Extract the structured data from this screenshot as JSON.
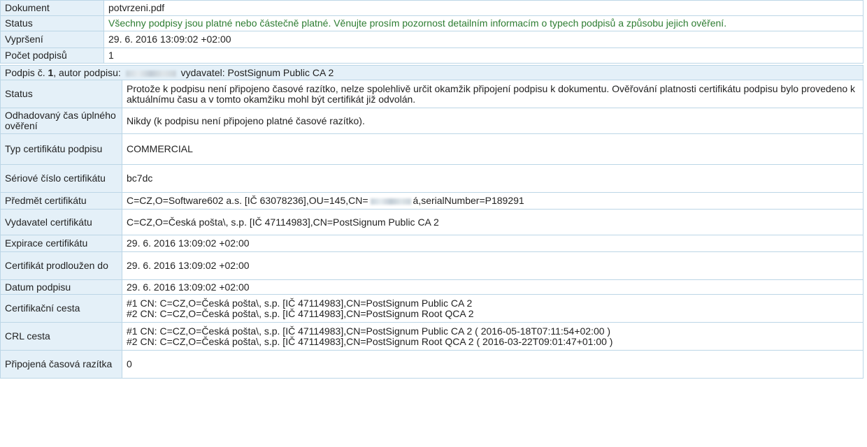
{
  "document": {
    "rows": [
      {
        "label": "Dokument",
        "value": "potvrzeni.pdf"
      },
      {
        "label": "Status",
        "value": "Všechny podpisy jsou platné nebo částečně platné. Věnujte prosím pozornost detailním informacím o typech podpisů a způsobu jejich ověření."
      },
      {
        "label": "Vypršení",
        "value": "29. 6. 2016 13:09:02 +02:00"
      },
      {
        "label": "Počet podpisů",
        "value": "1"
      }
    ]
  },
  "signature": {
    "header_prefix": "Podpis č.",
    "number": "1",
    "author_label": ", autor podpisu:",
    "issuer_label": "vydavatel: PostSignum Public CA 2",
    "status_label": "Status",
    "status_value": "Protože k podpisu není připojeno časové razítko, nelze spolehlivě určit okamžik připojení podpisu k dokumentu. Ověřování platnosti certifikátu podpisu bylo provedeno k aktuálnímu času a v tomto okamžiku mohl být certifikát již odvolán.",
    "estimated_time_label": "Odhadovaný čas úplného ověření",
    "estimated_time_value": "Nikdy (k podpisu není připojeno platné časové razítko).",
    "cert_type_label": "Typ certifikátu podpisu",
    "cert_type_value": "COMMERCIAL",
    "serial_label": "Sériové číslo certifikátu",
    "serial_value": "bc7dc",
    "subject_label": "Předmět certifikátu",
    "subject_value_prefix": "C=CZ,O=Software602 a.s. [IČ 63078236],OU=145,CN=",
    "subject_value_suffix": "á,serialNumber=P189291",
    "issuer_row_label": "Vydavatel certifikátu",
    "issuer_row_value": "C=CZ,O=Česká pošta\\, s.p. [IČ 47114983],CN=PostSignum Public CA 2",
    "expiry_label": "Expirace certifikátu",
    "expiry_value": "29. 6. 2016 13:09:02 +02:00",
    "extended_label": "Certifikát prodloužen do",
    "extended_value": "29. 6. 2016 13:09:02 +02:00",
    "sign_date_label": "Datum podpisu",
    "sign_date_value": "29. 6. 2016 13:09:02 +02:00",
    "cert_path_label": "Certifikační cesta",
    "cert_path": [
      "#1 CN: C=CZ,O=Česká pošta\\, s.p. [IČ 47114983],CN=PostSignum Public CA 2",
      "#2 CN: C=CZ,O=Česká pošta\\, s.p. [IČ 47114983],CN=PostSignum Root QCA 2"
    ],
    "crl_label": "CRL cesta",
    "crl_path": [
      "#1 CN: C=CZ,O=Česká pošta\\, s.p. [IČ 47114983],CN=PostSignum Public CA 2 ( 2016-05-18T07:11:54+02:00 )",
      "#2 CN: C=CZ,O=Česká pošta\\, s.p. [IČ 47114983],CN=PostSignum Root QCA 2 ( 2016-03-22T09:01:47+01:00 )"
    ],
    "timestamps_label": "Připojená časová razítka",
    "timestamps_value": "0"
  }
}
